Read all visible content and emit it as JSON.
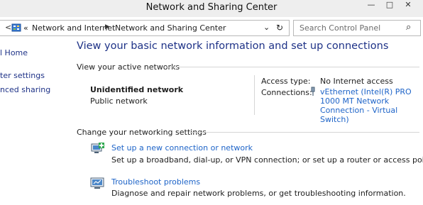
{
  "window": {
    "title": "Network and Sharing Center",
    "minimize": "—",
    "maximize": "□",
    "close": "✕"
  },
  "address": {
    "back_label": "<",
    "forward_label": ">",
    "overflow_label": "«",
    "crumbs": [
      "Network and Internet",
      "Network and Sharing Center"
    ],
    "dropdown_label": "⌄",
    "refresh_label": "↻",
    "search_placeholder": "Search Control Panel",
    "search_icon": "⌕"
  },
  "left_nav": {
    "home": "l Home",
    "adapter": "ter settings",
    "sharing": "nced sharing"
  },
  "main": {
    "title": "View your basic network information and set up connections",
    "active_section": "View your active networks",
    "network_name": "Unidentified network",
    "network_type": "Public network",
    "access_type_label": "Access type:",
    "access_type_value": "No Internet access",
    "connections_label": "Connections:",
    "connection_link": "vEthernet (Intel(R) PRO 1000 MT Network Connection - Virtual Switch)",
    "change_section": "Change your networking settings",
    "tasks": [
      {
        "link": "Set up a new connection or network",
        "desc": "Set up a broadband, dial-up, or VPN connection; or set up a router or access point."
      },
      {
        "link": "Troubleshoot problems",
        "desc": "Diagnose and repair network problems, or get troubleshooting information."
      }
    ]
  },
  "colors": {
    "link": "#1e64c8",
    "heading": "#1e3287",
    "rule": "#d5d5d5"
  }
}
